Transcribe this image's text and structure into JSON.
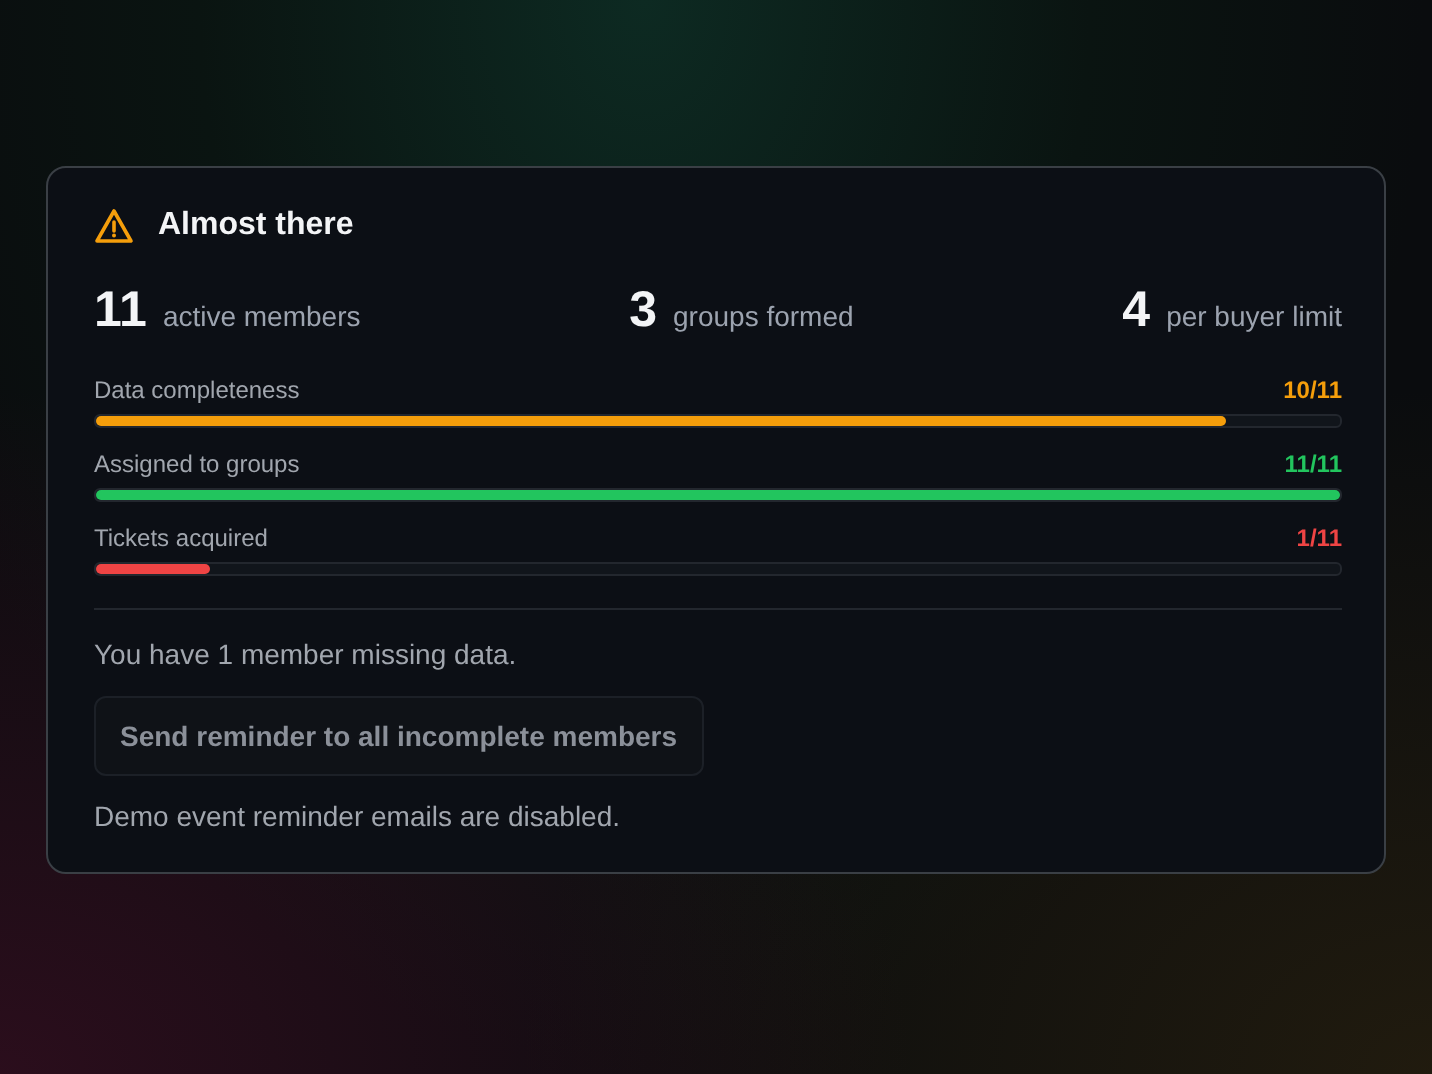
{
  "card": {
    "title": "Almost there",
    "stats": [
      {
        "value": "11",
        "label": "active members"
      },
      {
        "value": "3",
        "label": "groups formed"
      },
      {
        "value": "4",
        "label": "per buyer limit"
      }
    ],
    "progress": [
      {
        "label": "Data completeness",
        "reading": "10/11",
        "level": 0.909,
        "color": "#f59e0b"
      },
      {
        "label": "Assigned to groups",
        "reading": "11/11",
        "level": 1,
        "color": "#22c55e"
      },
      {
        "label": "Tickets acquired",
        "reading": "1/11",
        "level": 0.0909,
        "color": "#ef4444"
      }
    ],
    "message": "You have 1 member missing data.",
    "button": {
      "label": "Send reminder to all incomplete members",
      "disabled": true
    },
    "note": "Demo event reminder emails are disabled."
  }
}
